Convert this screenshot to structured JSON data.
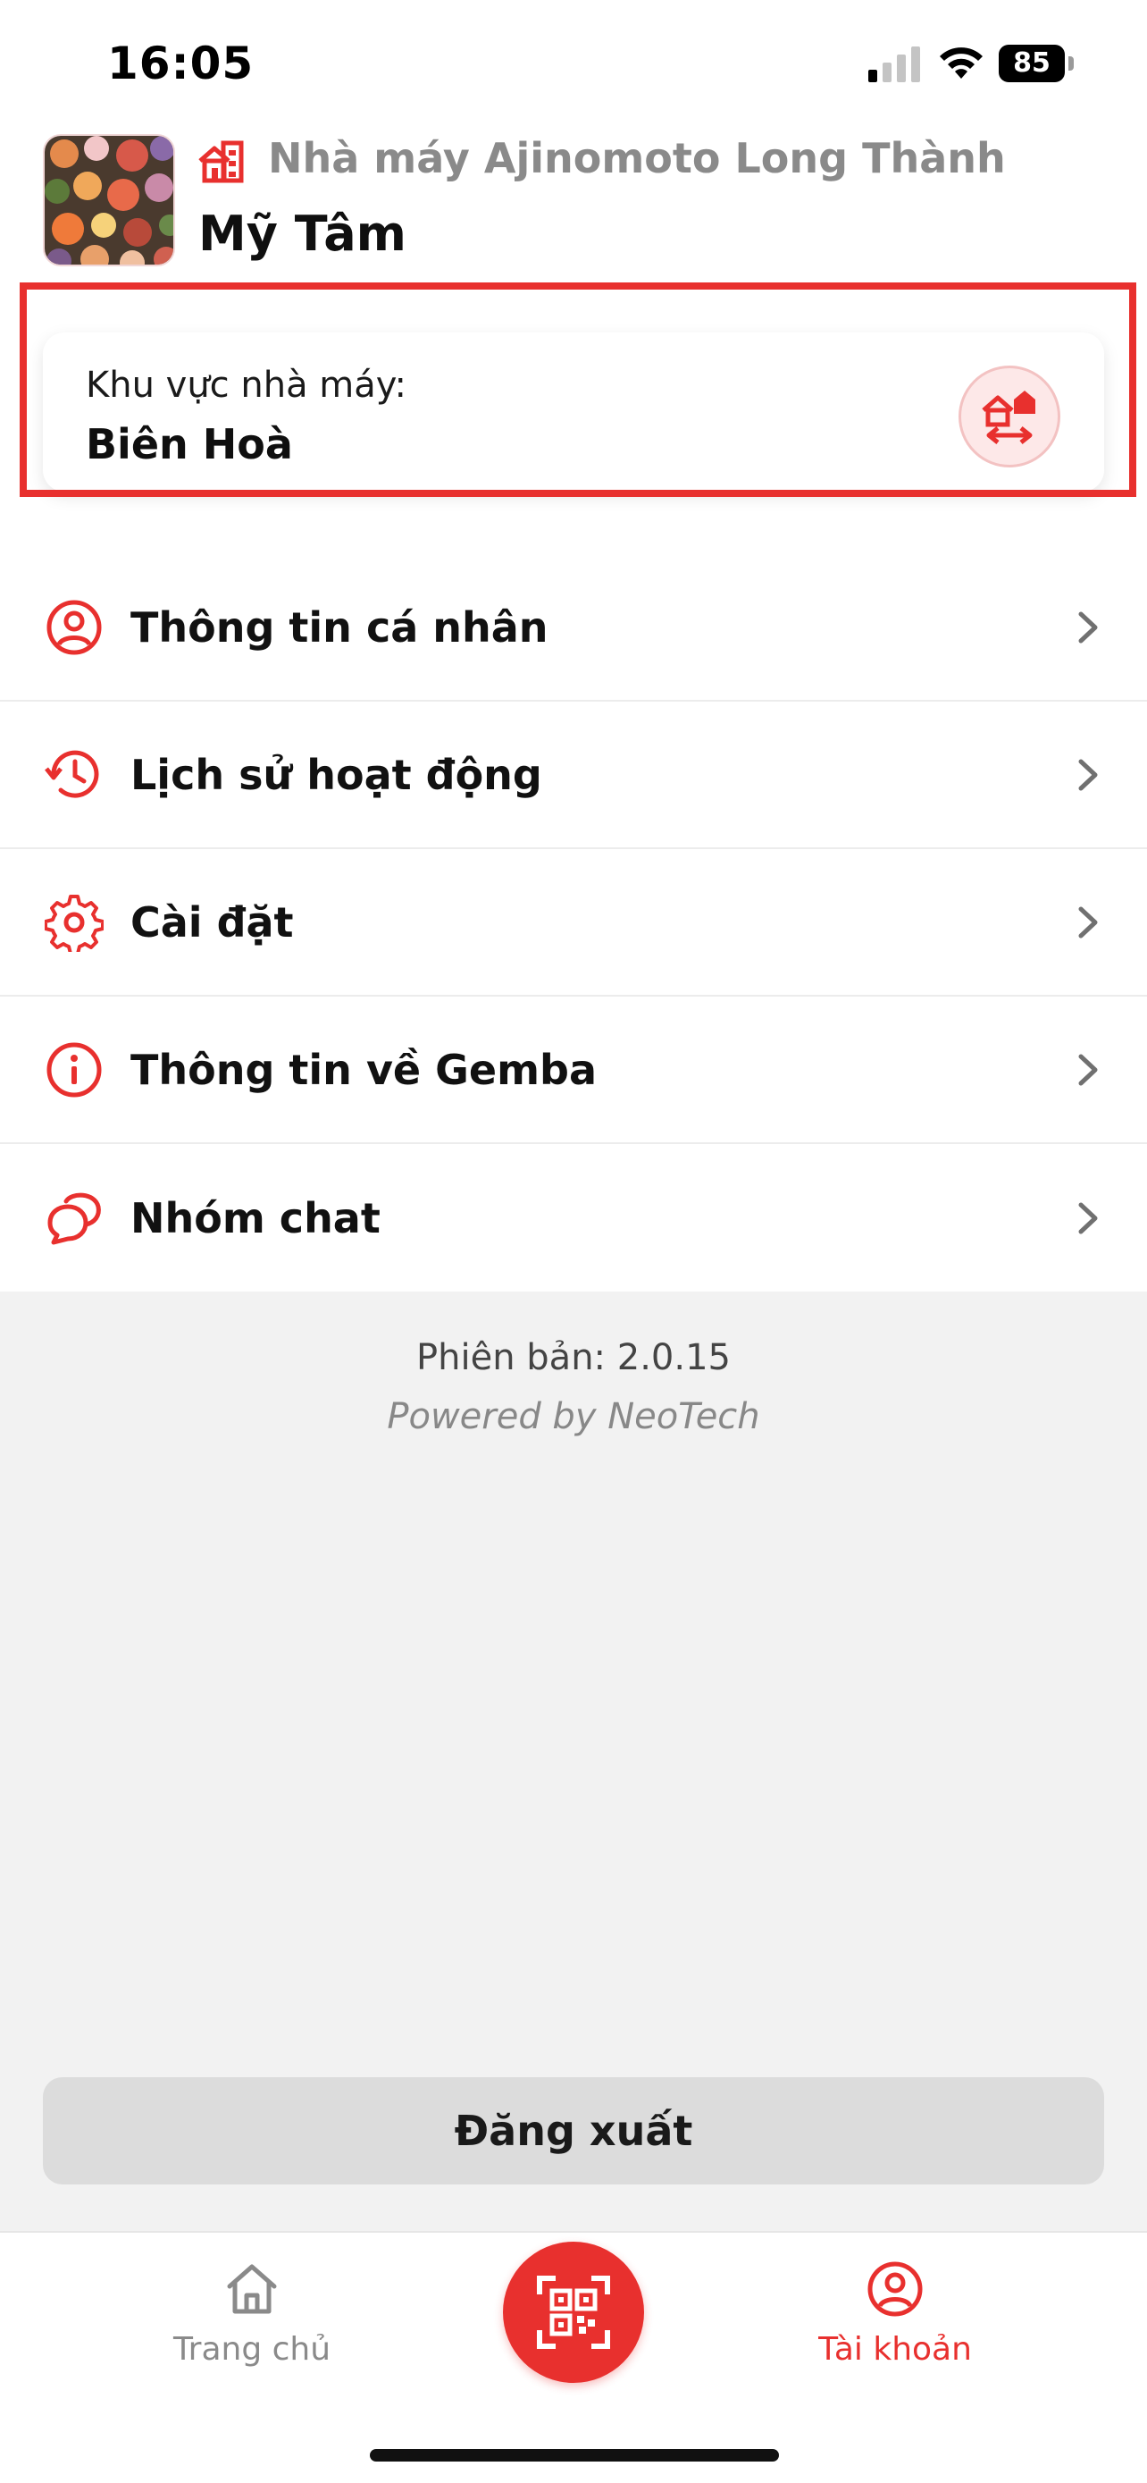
{
  "status_bar": {
    "time": "16:05",
    "battery": "85"
  },
  "header": {
    "factory_name": "Nhà máy Ajinomoto Long Thành",
    "user_name": "Mỹ Tâm"
  },
  "area_card": {
    "label": "Khu vực nhà máy:",
    "value": "Biên Hoà"
  },
  "menu": {
    "items": [
      {
        "label": "Thông tin cá nhân",
        "icon": "user-circle-icon"
      },
      {
        "label": "Lịch sử hoạt động",
        "icon": "history-icon"
      },
      {
        "label": "Cài đặt",
        "icon": "gear-icon"
      },
      {
        "label": "Thông tin về Gemba",
        "icon": "info-icon"
      },
      {
        "label": "Nhóm chat",
        "icon": "chat-icon"
      }
    ]
  },
  "footer": {
    "version": "Phiên bản: 2.0.15",
    "powered": "Powered by NeoTech"
  },
  "logout_label": "Đăng xuất",
  "tabbar": {
    "home_label": "Trang chủ",
    "account_label": "Tài khoản"
  },
  "colors": {
    "accent": "#e8302e",
    "muted": "#8a8a8a",
    "background": "#f2f2f2"
  }
}
